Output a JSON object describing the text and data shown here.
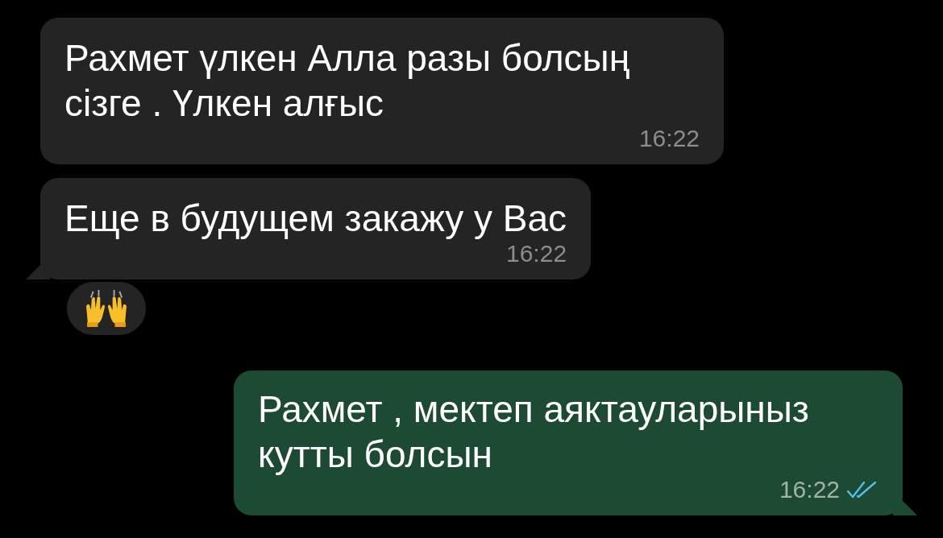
{
  "messages": [
    {
      "kind": "incoming",
      "text": "Рахмет үлкен Алла разы болсың сізге . Үлкен алғыс",
      "time": "16:22",
      "tail": false,
      "reaction": false
    },
    {
      "kind": "incoming",
      "text": "Еще в будущем закажу у Вас",
      "time": "16:22",
      "tail": true,
      "reaction": true
    },
    {
      "kind": "outgoing",
      "text": "Рахмет , мектеп аяктауларыныз кутты болсын",
      "time": "16:22",
      "tail": true,
      "read": true
    }
  ]
}
